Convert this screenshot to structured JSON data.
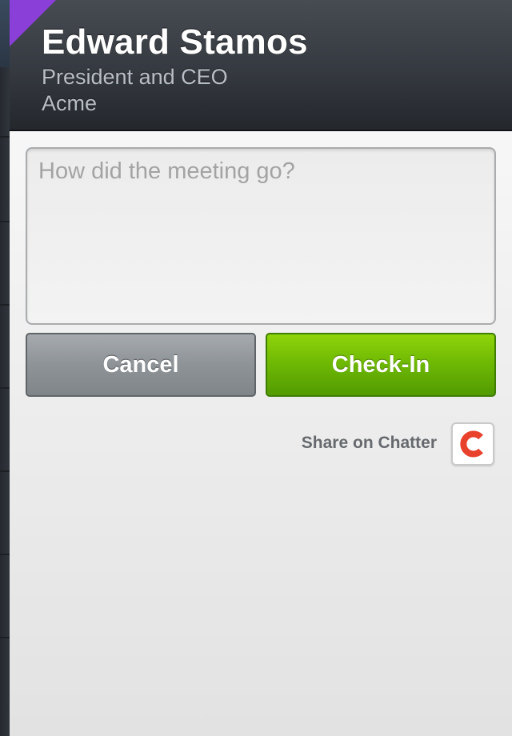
{
  "contact": {
    "name": "Edward Stamos",
    "title": "President and CEO",
    "company": "Acme"
  },
  "checkin_form": {
    "notes_placeholder": "How did the meeting go?",
    "notes_value": "",
    "cancel_label": "Cancel",
    "checkin_label": "Check-In"
  },
  "share": {
    "label": "Share on Chatter",
    "icon": "chatter-c-icon"
  },
  "colors": {
    "accent_flag": "#8a3fd9",
    "checkin_green": "#6db704",
    "cancel_gray": "#8e9398",
    "chatter_red": "#e8412c"
  }
}
